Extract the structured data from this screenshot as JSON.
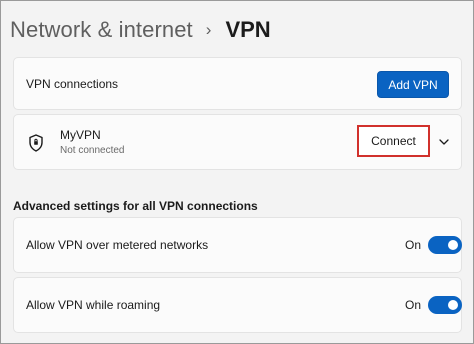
{
  "breadcrumb": {
    "parent": "Network & internet",
    "separator": "›",
    "current": "VPN"
  },
  "connections_card": {
    "label": "VPN connections",
    "add_button_label": "Add VPN"
  },
  "vpn_entry": {
    "name": "MyVPN",
    "status": "Not connected",
    "connect_label": "Connect",
    "icon": "shield-icon",
    "expand_icon": "chevron-down-icon"
  },
  "advanced": {
    "heading": "Advanced settings for all VPN connections",
    "settings": [
      {
        "label": "Allow VPN over metered networks",
        "state_label": "On",
        "on": true
      },
      {
        "label": "Allow VPN while roaming",
        "state_label": "On",
        "on": true
      }
    ]
  },
  "colors": {
    "accent": "#0a63c2",
    "highlight_border": "#d1312c",
    "background": "#f3f3f3",
    "card": "#fbfbfb"
  }
}
